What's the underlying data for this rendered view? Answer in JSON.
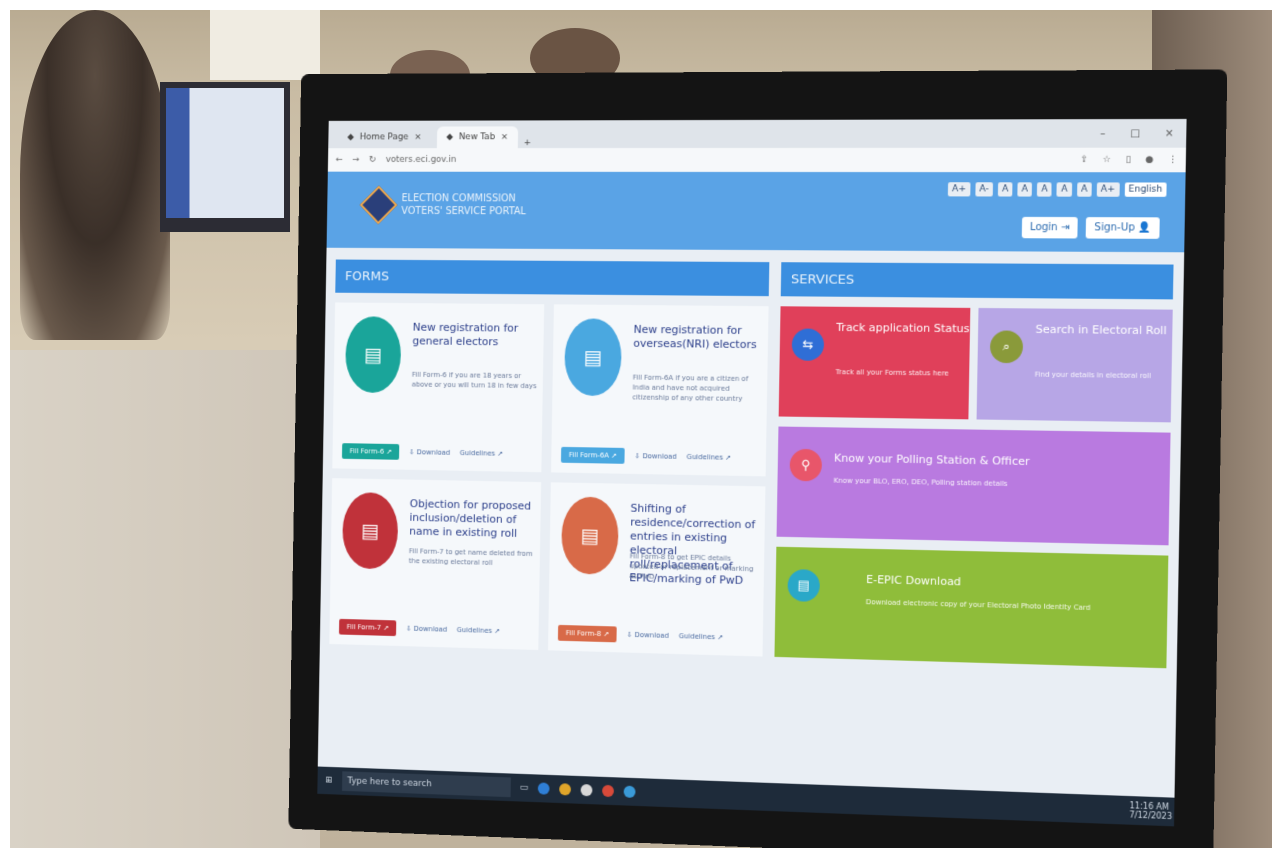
{
  "browser": {
    "tabs": [
      {
        "label": "Home Page"
      },
      {
        "label": "New Tab"
      }
    ],
    "new_tab": "+",
    "url": "voters.eci.gov.in",
    "window_controls": [
      "–",
      "□",
      "×"
    ]
  },
  "site": {
    "logo_line1": "ELECTION COMMISSION",
    "logo_line2": "VOTERS' SERVICE PORTAL",
    "font_sizes": [
      "A+",
      "A-",
      "A",
      "A",
      "A",
      "A",
      "A",
      "A+"
    ],
    "language": "English",
    "login_label": "Login ⇥",
    "signup_label": "Sign-Up 👤"
  },
  "forms": {
    "heading": "FORMS",
    "cards": [
      {
        "title": "New registration for general electors",
        "desc": "Fill Form-6 if you are 18 years or above or you will turn 18 in few days",
        "apply": "Fill Form-6 ↗",
        "download": "⇩ Download",
        "guidelines": "Guidelines ↗",
        "color": "#1aa59a"
      },
      {
        "title": "New registration for overseas(NRI) electors",
        "desc": "Fill Form-6A if you are a citizen of India and have not acquired citizenship of any other country",
        "apply": "Fill Form-6A ↗",
        "download": "⇩ Download",
        "guidelines": "Guidelines ↗",
        "color": "#4aa8e0"
      },
      {
        "title": "Objection for proposed inclusion/deletion of name in existing roll",
        "desc": "Fill Form-7 to get name deleted from the existing electoral roll",
        "apply": "Fill Form-7 ↗",
        "download": "⇩ Download",
        "guidelines": "Guidelines ↗",
        "color": "#c0323a"
      },
      {
        "title": "Shifting of residence/correction of entries in existing electoral roll/replacement of EPIC/marking of PwD",
        "desc": "Fill Form-8 to get EPIC details updated or replacement or marking as PwD",
        "apply": "Fill Form-8 ↗",
        "download": "⇩ Download",
        "guidelines": "Guidelines ↗",
        "color": "#d86a48"
      }
    ]
  },
  "services": {
    "heading": "SERVICES",
    "track": {
      "title": "Track application Status",
      "desc": "Track all your Forms status here",
      "color": "#e0405a"
    },
    "search": {
      "title": "Search in Electoral Roll",
      "desc": "Find your details in electoral roll",
      "color": "#b7a6e6"
    },
    "polling": {
      "title": "Know your Polling Station & Officer",
      "desc": "Know your BLO, ERO, DEO, Polling station details",
      "color": "#b97ae0"
    },
    "epic": {
      "title": "E-EPIC Download",
      "desc": "Download electronic copy of your Electoral Photo Identity Card",
      "color": "#8fbd3a"
    }
  },
  "taskbar": {
    "search_placeholder": "Type here to search",
    "time": "11:16 AM",
    "date": "7/12/2023"
  }
}
